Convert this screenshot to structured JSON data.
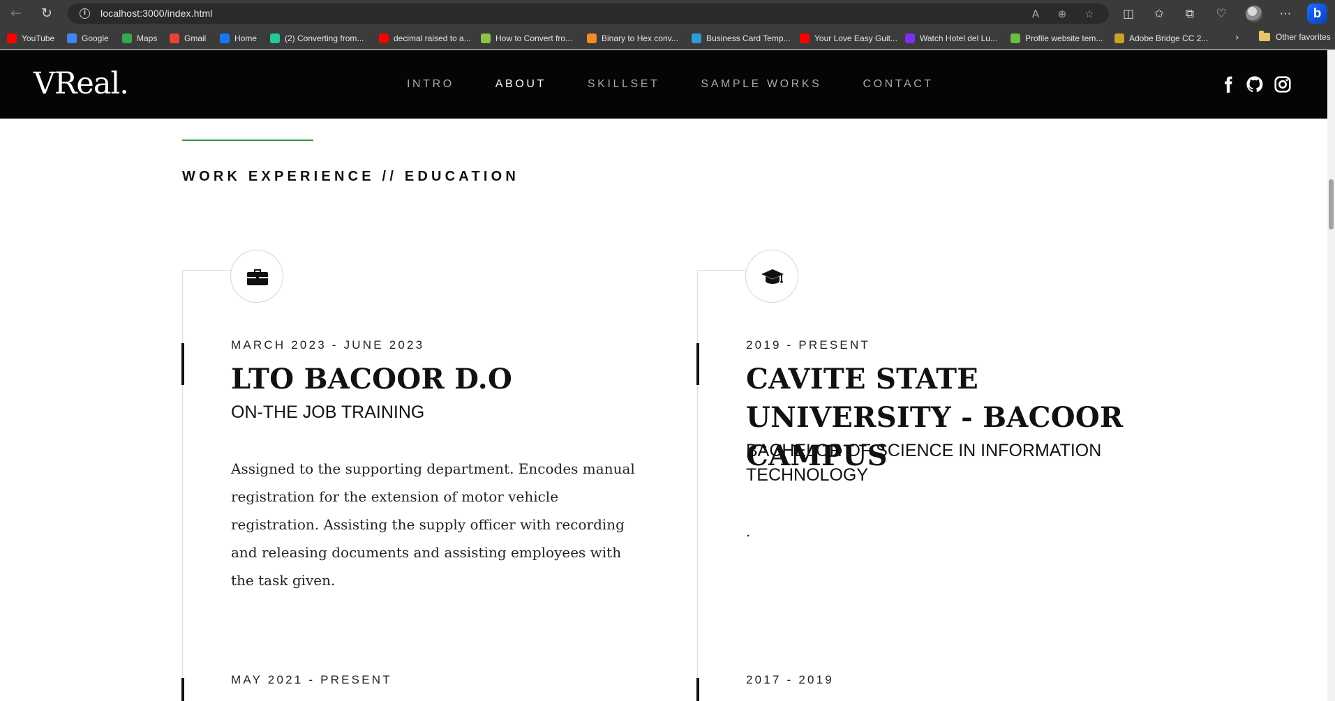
{
  "browser": {
    "url": "localhost:3000/index.html",
    "bookmarks": [
      {
        "label": "YouTube",
        "color": "#ff0000"
      },
      {
        "label": "Google",
        "color": "#4285f4"
      },
      {
        "label": "Maps",
        "color": "#34a853"
      },
      {
        "label": "Gmail",
        "color": "#ea4335"
      },
      {
        "label": "Home",
        "color": "#1877f2"
      },
      {
        "label": "(2) Converting from...",
        "color": "#20c997"
      },
      {
        "label": "decimal raised to a...",
        "color": "#ff0000"
      },
      {
        "label": "How to Convert fro...",
        "color": "#8bc34a"
      },
      {
        "label": "Binary to Hex conv...",
        "color": "#f28c28"
      },
      {
        "label": "Business Card Temp...",
        "color": "#2d9cdb"
      },
      {
        "label": "Your Love Easy Guit...",
        "color": "#ff0000"
      },
      {
        "label": "Watch Hotel del Lu...",
        "color": "#7b2ff7"
      },
      {
        "label": "Profile website tem...",
        "color": "#6abf40"
      },
      {
        "label": "Adobe Bridge CC 2...",
        "color": "#c9a227"
      }
    ],
    "other_favorites": "Other favorites"
  },
  "site": {
    "logo": "VReal.",
    "nav": [
      {
        "label": "INTRO",
        "active": false
      },
      {
        "label": "ABOUT",
        "active": true
      },
      {
        "label": "SKILLSET",
        "active": false
      },
      {
        "label": "SAMPLE WORKS",
        "active": false
      },
      {
        "label": "CONTACT",
        "active": false
      }
    ],
    "social_icons": [
      "facebook-icon",
      "github-icon",
      "instagram-icon"
    ]
  },
  "section": {
    "title": "WORK EXPERIENCE // EDUCATION",
    "accent_color": "#2b9a3e"
  },
  "work": {
    "icon": "briefcase-icon",
    "entries": [
      {
        "date": "MARCH 2023 - JUNE 2023",
        "org": "LTO BACOOR D.O",
        "role": "ON-THE JOB TRAINING",
        "description": "Assigned to the supporting department. Encodes manual registration for the extension of motor vehicle registration. Assisting the supply officer with recording and releasing documents and assisting employees with the task given."
      },
      {
        "date": "MAY 2021 - PRESENT"
      }
    ]
  },
  "education": {
    "icon": "graduation-cap-icon",
    "entries": [
      {
        "date": "2019 - PRESENT",
        "org": "CAVITE STATE UNIVERSITY - BACOOR CAMPUS",
        "role": "BACHELOR OF SCIENCE IN INFORMATION TECHNOLOGY",
        "description": "."
      },
      {
        "date": "2017 - 2019"
      }
    ]
  }
}
